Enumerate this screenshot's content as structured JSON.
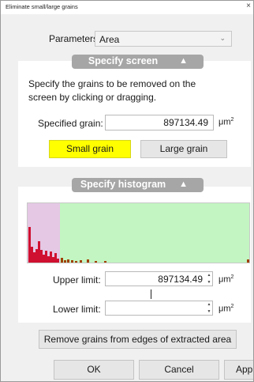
{
  "window": {
    "title": "Eliminate small/large grains",
    "close_glyph": "×"
  },
  "parameters": {
    "label": "Parameters:",
    "selected": "Area"
  },
  "screen_section": {
    "header": "Specify screen",
    "instructions_line1": "Specify the grains to be removed on the",
    "instructions_line2": "screen by clicking or dragging.",
    "specified_grain_label": "Specified grain:",
    "specified_grain_value": "897134.49",
    "unit": "μm",
    "small_grain_button": "Small grain",
    "large_grain_button": "Large grain"
  },
  "histogram_section": {
    "header": "Specify histogram",
    "upper_limit_label": "Upper limit:",
    "upper_limit_value": "897134.49",
    "lower_limit_label": "Lower limit:",
    "lower_limit_value": "",
    "unit": "μm",
    "colors": {
      "selected_region": "#e4c8e4",
      "remaining_region": "#c2f5c2",
      "small_bars": "#d01030",
      "large_bars": "#a04000"
    }
  },
  "edge_button": "Remove grains from edges of extracted area",
  "footer": {
    "ok": "OK",
    "cancel": "Cancel",
    "apply": "Apply"
  }
}
